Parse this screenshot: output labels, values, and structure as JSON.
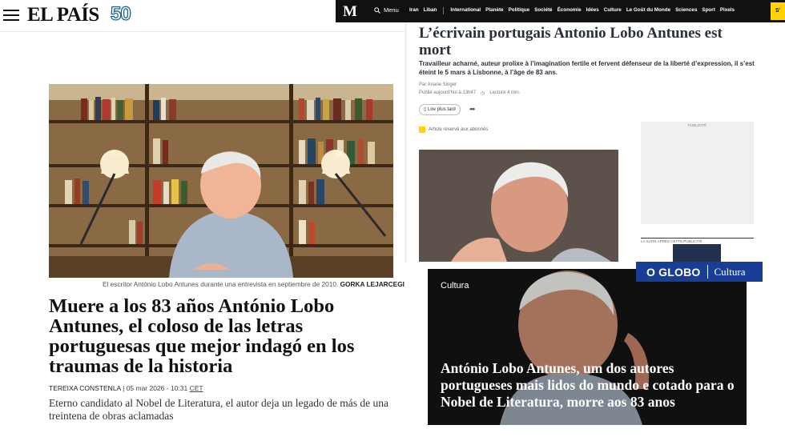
{
  "elpais": {
    "logo": "EL PAÍS",
    "anniversary": "50",
    "caption_text": "El escritor António Lobo Antunes durante una entrevista en septiembre de 2010. ",
    "caption_credit": "GORKA LEJARCEGI",
    "headline": "Muere a los 83 años António Lobo Antunes, el coloso de las letras portuguesas que mejor indagó en los traumas de la historia",
    "author": "Tereixa Constenla",
    "date": " | 05 mar 2026 - 10:31 ",
    "timezone": "CET",
    "subtitle": "Eterno candidato al Nobel de Literatura, el autor deja un legado de más de una treintena de obras aclamadas"
  },
  "lemonde": {
    "logo": "M",
    "menu_label": "Menu",
    "nav": [
      "Iran",
      "Liban",
      "International",
      "Planète",
      "Politique",
      "Société",
      "Économie",
      "Idées",
      "Culture",
      "Le Goût du Monde",
      "Sciences",
      "Sport",
      "Pixels"
    ],
    "subscribe_label": "S'",
    "title": "L’écrivain portugais Antonio Lobo Antunes est mort",
    "lede": "Travailleur acharné, auteur prolixe à l’imagination fertile et fervent défenseur de la liberté d’expression, il s’est éteint le 5 mars à Lisbonne, à l’âge de 83 ans.",
    "author": "Par Ariane Singer",
    "published": "Publié aujourd’hui à 13h47",
    "reading_time": "Lecture 4 min.",
    "save_label": "Lire plus tard",
    "subscriber_note": "Article réservé aux abonnés",
    "ad_label": "PUBLICITÉ",
    "ad_label2": "LA SUITE APRÈS CETTE PUBLICITÉ"
  },
  "oglobo": {
    "brand": "O GLOBO",
    "section": "Cultura",
    "card_section": "Cultura",
    "headline": "António Lobo Antunes, um dos autores portugueses mais lidos do mundo e cotado para o Nobel de Literatura, morre aos 83 anos"
  }
}
